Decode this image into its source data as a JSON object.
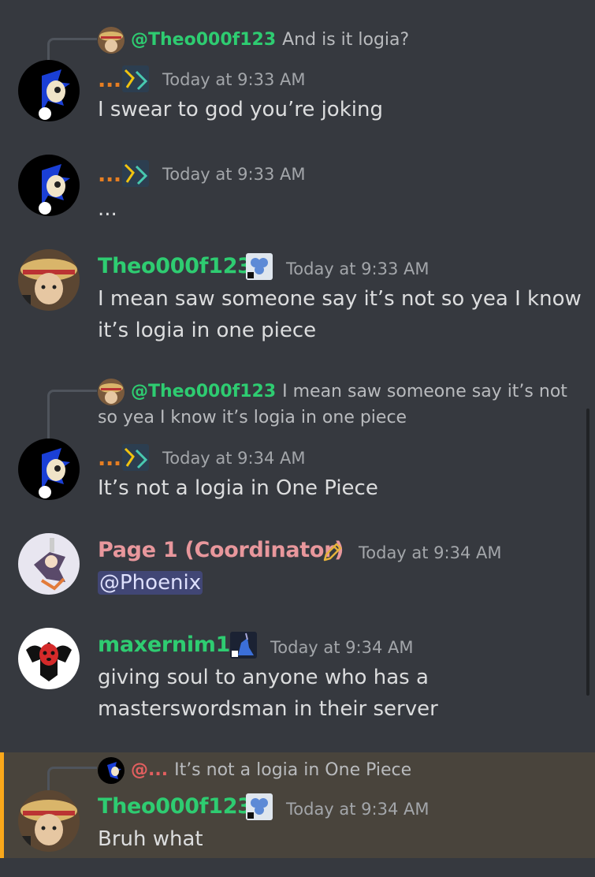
{
  "colors": {
    "background": "#36393f",
    "green_name": "#2ecc71",
    "pink_name": "#e8979c",
    "orange_name": "#e67e22",
    "red_name": "#e25f5f",
    "timestamp": "#a3a6aa",
    "highlight_border": "#faa81a"
  },
  "messages": [
    {
      "reply": {
        "name": "@Theo000f123",
        "text": "And is it logia?"
      },
      "author": "...",
      "timestamp": "Today at 9:33 AM",
      "lines": [
        "I swear to god you’re joking"
      ]
    },
    {
      "author": "...",
      "timestamp": "Today at 9:33 AM",
      "lines": [
        "..."
      ]
    },
    {
      "author": "Theo000f123",
      "timestamp": "Today at 9:33 AM",
      "lines": [
        "I mean saw someone say it’s not so yea I know",
        "it’s logia in one piece"
      ]
    },
    {
      "reply": {
        "name": "@Theo000f123",
        "text": "I mean saw someone say it’s not",
        "text2": "so yea I know it’s logia in one piece"
      },
      "author": "...",
      "timestamp": "Today at 9:34 AM",
      "lines": [
        "It’s not a logia in One Piece"
      ]
    },
    {
      "author": "Page 1 (Coordinator)",
      "timestamp": "Today at 9:34 AM",
      "mention": "@Phoenix"
    },
    {
      "author": "maxernim13",
      "timestamp": "Today at 9:34 AM",
      "lines": [
        "giving soul to anyone who has a",
        "masterswordsman in their server"
      ]
    },
    {
      "reply": {
        "name": "@...",
        "text": "It’s not a logia in One Piece"
      },
      "author": "Theo000f123",
      "timestamp": "Today at 9:34 AM",
      "lines": [
        "Bruh what"
      ]
    }
  ]
}
